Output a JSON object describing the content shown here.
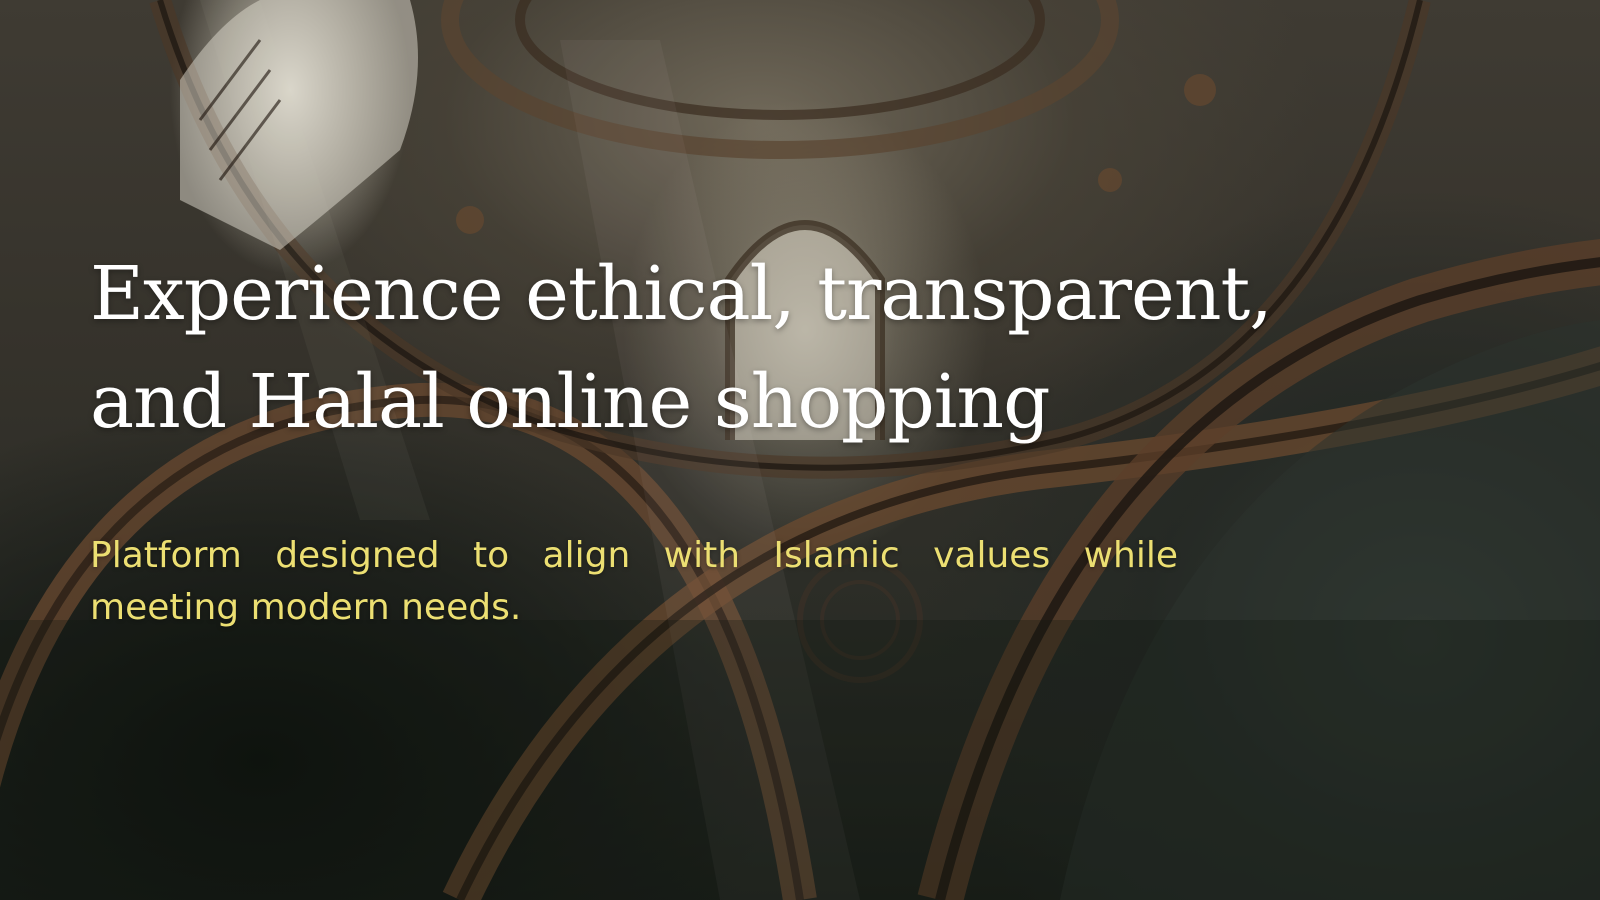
{
  "hero": {
    "headline": "Experience ethical, transparent, and Halal online shopping",
    "subtitle": "Platform designed to align with Islamic values while meeting modern needs."
  },
  "colors": {
    "headline_text": "#ffffff",
    "subtitle_text": "#ecdf72",
    "background_dark": "#1d211c"
  }
}
